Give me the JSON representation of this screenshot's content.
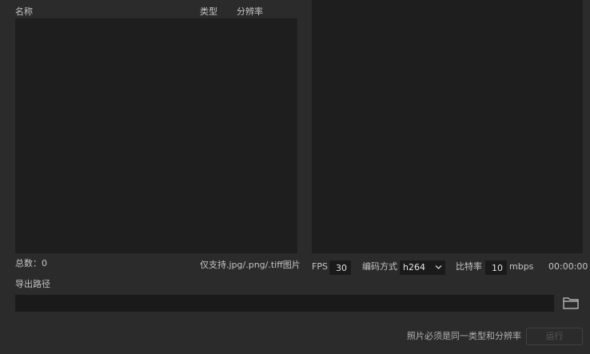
{
  "file_list": {
    "columns": [
      "名称",
      "类型",
      "分辨率"
    ],
    "total_label": "总数：0",
    "support_note": "仅支持.jpg/.png/.tiff图片"
  },
  "video_settings": {
    "fps_label": "FPS",
    "fps_value": "30",
    "codec_label": "编码方式",
    "codec_value": "h264",
    "bitrate_label": "比特率",
    "bitrate_value": "10",
    "bitrate_unit": "mbps",
    "duration": "00:00:00"
  },
  "export": {
    "path_label": "导出路径",
    "path_value": "",
    "folder_icon": "folder-icon"
  },
  "footer": {
    "note": "照片必须是同一类型和分辨率",
    "run_button": "运行"
  },
  "colors": {
    "background": "#2b2b2b",
    "panel": "#1e1e1e",
    "field": "#1a1a1a",
    "disabled_text": "#5a5a5a"
  }
}
